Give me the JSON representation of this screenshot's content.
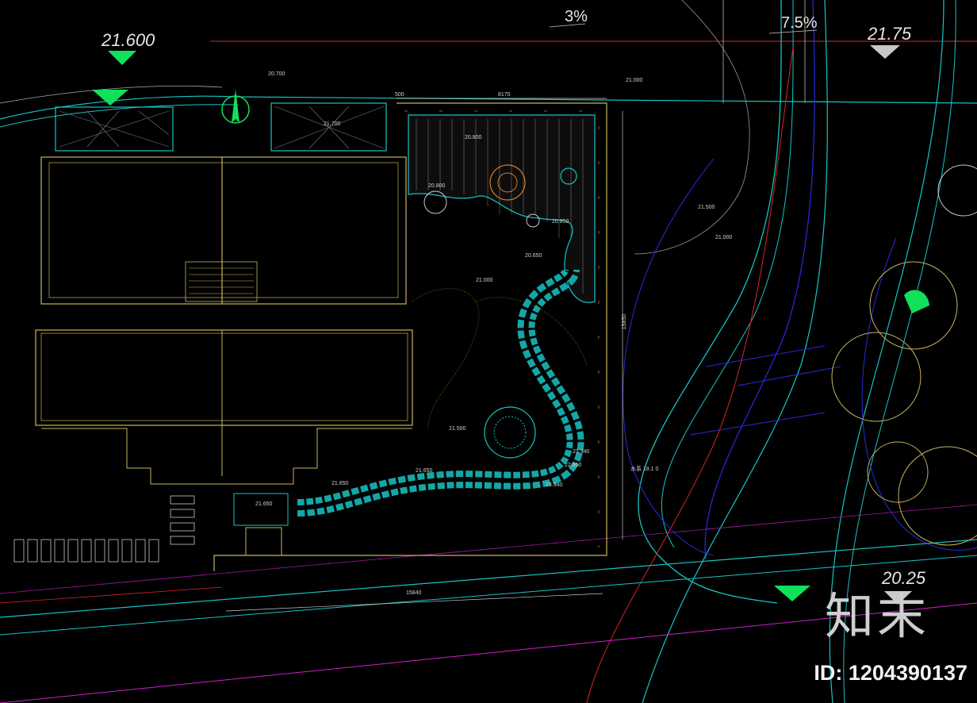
{
  "elevations": {
    "top_left": "21.600",
    "top_right": "21.75",
    "bottom_right": "20.25"
  },
  "slopes": {
    "slope_a": "3%",
    "slope_b": "7.5%"
  },
  "small_labels": {
    "deck_top": "20.700",
    "left_court": "21.700",
    "top_right_lawn": "21.000",
    "deck_center": "20.800",
    "circle_left": "20.800",
    "circle_small": "20.850",
    "lawn_center": "20.650",
    "contour_a": "21.500",
    "contour_b": "21.000",
    "contour_c": "21.000",
    "contour_d": "21.500",
    "path_a": "21.650",
    "path_b": "21.650",
    "bottom_box": "21.650",
    "right_step_a": "23.340",
    "right_step_b": "22.850",
    "right_step_c": "23.340",
    "dim_top_left": "500",
    "dim_top": "8170",
    "dim_right": "15850",
    "dim_bottom": "15840",
    "right_note": "水系 18.1 0"
  },
  "watermark": {
    "logo_text": "知末",
    "id_text": "ID: 1204390137"
  },
  "colors": {
    "background": "#000000",
    "cyan": "#16c4c4",
    "yellow": "#c8b45a",
    "green_marker": "#11e05a",
    "red": "#d8242a",
    "magenta": "#d020d0",
    "blue": "#2a2ae0",
    "orange": "#d27a2c"
  }
}
